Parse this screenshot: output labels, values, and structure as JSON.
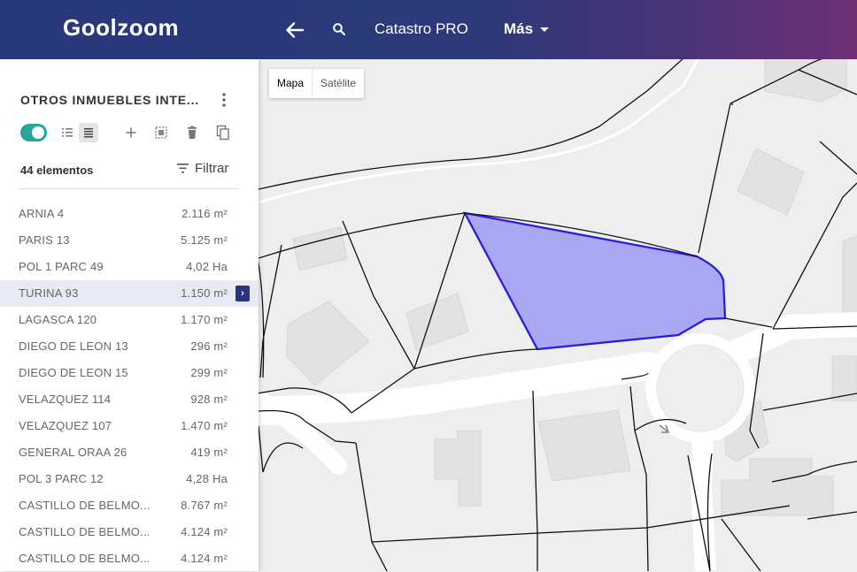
{
  "header": {
    "logo": "Goolzoom",
    "nav": {
      "catastro_label": "Catastro PRO",
      "mas_label": "Más"
    },
    "icons": {
      "back": "arrow-left-icon",
      "search": "search-icon",
      "dropdown": "caret-down-icon"
    }
  },
  "sidebar": {
    "title": "OTROS INMUEBLES INTE...",
    "count": "44 elementos",
    "filter_label": "Filtrar",
    "toolbar_icons": [
      "toggle-switch",
      "list-view-icon",
      "compact-list-icon",
      "add-icon",
      "select-area-icon",
      "delete-icon",
      "copy-icon"
    ],
    "items": [
      {
        "name": "ARNIA 4",
        "area": "2.116 m²"
      },
      {
        "name": "PARIS 13",
        "area": "5.125 m²"
      },
      {
        "name": "POL 1 PARC 49",
        "area": "4,02 Ha"
      },
      {
        "name": "TURINA 93",
        "area": "1.150 m²",
        "selected": true
      },
      {
        "name": "LAGASCA 120",
        "area": "1.170 m²"
      },
      {
        "name": "DIEGO DE LEON 13",
        "area": "296 m²"
      },
      {
        "name": "DIEGO DE LEON 15",
        "area": "299 m²"
      },
      {
        "name": "VELAZQUEZ 114",
        "area": "928 m²"
      },
      {
        "name": "VELAZQUEZ 107",
        "area": "1.470 m²"
      },
      {
        "name": "GENERAL ORAA 26",
        "area": "419 m²"
      },
      {
        "name": "POL 3 PARC 12",
        "area": "4,28 Ha"
      },
      {
        "name": "CASTILLO DE BELMO...",
        "area": "8.767 m²"
      },
      {
        "name": "CASTILLO DE BELMO...",
        "area": "4.124 m²"
      },
      {
        "name": "CASTILLO DE BELMO...",
        "area": "4.124 m²"
      }
    ]
  },
  "map": {
    "type_map": "Mapa",
    "type_satellite": "Satélite",
    "colors": {
      "parcel_fill": "#a9a7f2",
      "parcel_stroke": "#2a1ed8",
      "road": "#ffffff",
      "background": "#eeeeee",
      "building": "#e3e3e3"
    }
  }
}
